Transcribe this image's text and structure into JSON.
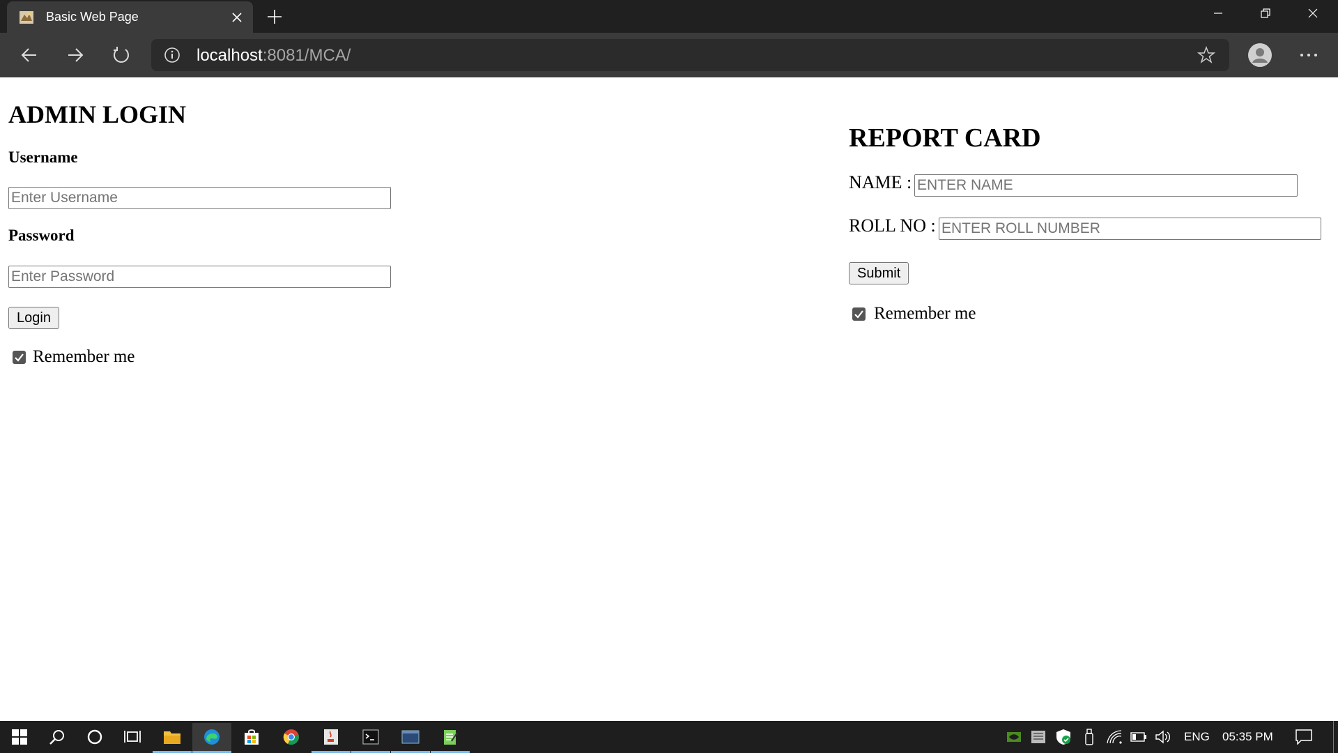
{
  "browser": {
    "tab_title": "Basic Web Page",
    "url_host": "localhost",
    "url_rest": ":8081/MCA/"
  },
  "login": {
    "title": "ADMIN LOGIN",
    "username_label": "Username",
    "username_placeholder": "Enter Username",
    "password_label": "Password",
    "password_placeholder": "Enter Password",
    "button_label": "Login",
    "remember_label": "Remember me",
    "remember_checked": true
  },
  "report": {
    "title": "REPORT CARD",
    "name_label": "NAME :",
    "name_placeholder": "ENTER NAME",
    "roll_label": "ROLL NO :",
    "roll_placeholder": "ENTER ROLL NUMBER",
    "button_label": "Submit",
    "remember_label": "Remember me",
    "remember_checked": true
  },
  "taskbar": {
    "language": "ENG",
    "time": "05:35 PM"
  },
  "colors": {
    "titlebar": "#202020",
    "toolbar": "#3b3b3b",
    "taskbar": "#1e1e1e",
    "accent_underline": "#76b9ed"
  }
}
